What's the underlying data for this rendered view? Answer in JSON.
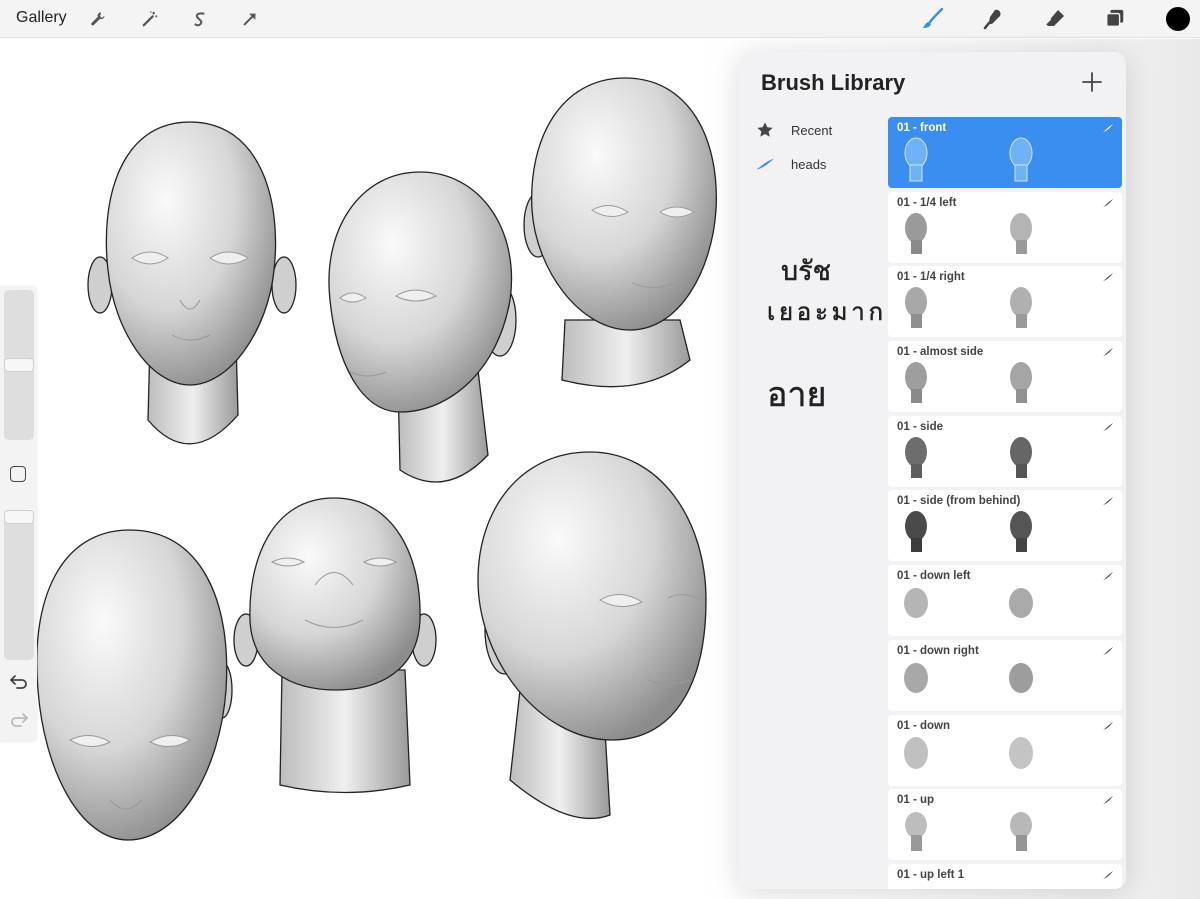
{
  "toolbar": {
    "gallery_label": "Gallery",
    "left_tools": [
      "wrench-icon",
      "magic-wand-icon",
      "selection-icon",
      "transform-arrow-icon"
    ],
    "right_tools": [
      "brush-icon",
      "smudge-icon",
      "eraser-icon",
      "layers-icon"
    ],
    "active_color": "#000000",
    "accent": "#3a8ef0"
  },
  "panel": {
    "title": "Brush Library",
    "sets": [
      {
        "label": "Recent",
        "icon": "star-icon"
      },
      {
        "label": "heads",
        "icon": "brush-stroke-icon"
      }
    ],
    "brushes": [
      {
        "name": "01 - front",
        "selected": true
      },
      {
        "name": "01 - 1/4 left",
        "selected": false
      },
      {
        "name": "01 - 1/4 right",
        "selected": false
      },
      {
        "name": "01 - almost side",
        "selected": false
      },
      {
        "name": "01 - side",
        "selected": false
      },
      {
        "name": "01 - side (from behind)",
        "selected": false
      },
      {
        "name": "01 - down left",
        "selected": false
      },
      {
        "name": "01 - down right",
        "selected": false
      },
      {
        "name": "01 - down",
        "selected": false
      },
      {
        "name": "01 - up",
        "selected": false
      },
      {
        "name": "01 - up left 1",
        "selected": false
      }
    ]
  },
  "handwriting": {
    "line1": "บรัช",
    "line2": "เยอะมาก",
    "line3": "อาย"
  }
}
